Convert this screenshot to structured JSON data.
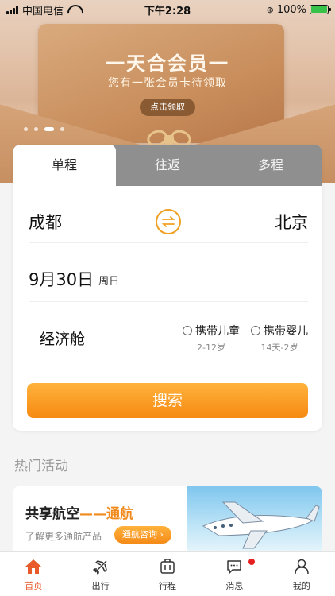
{
  "status_bar": {
    "carrier": "中国电信",
    "time": "下午2:28",
    "battery": "100%"
  },
  "banner": {
    "title": "一天合会员一",
    "subtitle": "您有一张会员卡待领取",
    "button": "点击领取",
    "pager": {
      "count": 4,
      "active": 2
    }
  },
  "booking": {
    "tabs": [
      "单程",
      "往返",
      "多程"
    ],
    "active_tab": 0,
    "from_city": "成都",
    "to_city": "北京",
    "date": "9月30日",
    "weekday": "周日",
    "cabin": "经济舱",
    "options": [
      {
        "label": "携带儿童",
        "age": "2-12岁"
      },
      {
        "label": "携带婴儿",
        "age": "14天-2岁"
      }
    ],
    "search_label": "搜索"
  },
  "hot": {
    "section_title": "热门活动",
    "promo_title_a": "共享航空",
    "promo_title_dash": "——",
    "promo_title_b": "通航",
    "promo_sub": "了解更多通航产品",
    "promo_cta": "通航咨询 ›"
  },
  "tabbar": {
    "items": [
      "首页",
      "出行",
      "行程",
      "消息",
      "我的"
    ],
    "active": 0
  },
  "colors": {
    "accent": "#f68a12",
    "active_tab": "#e85a2a",
    "badge": "#e62020"
  }
}
